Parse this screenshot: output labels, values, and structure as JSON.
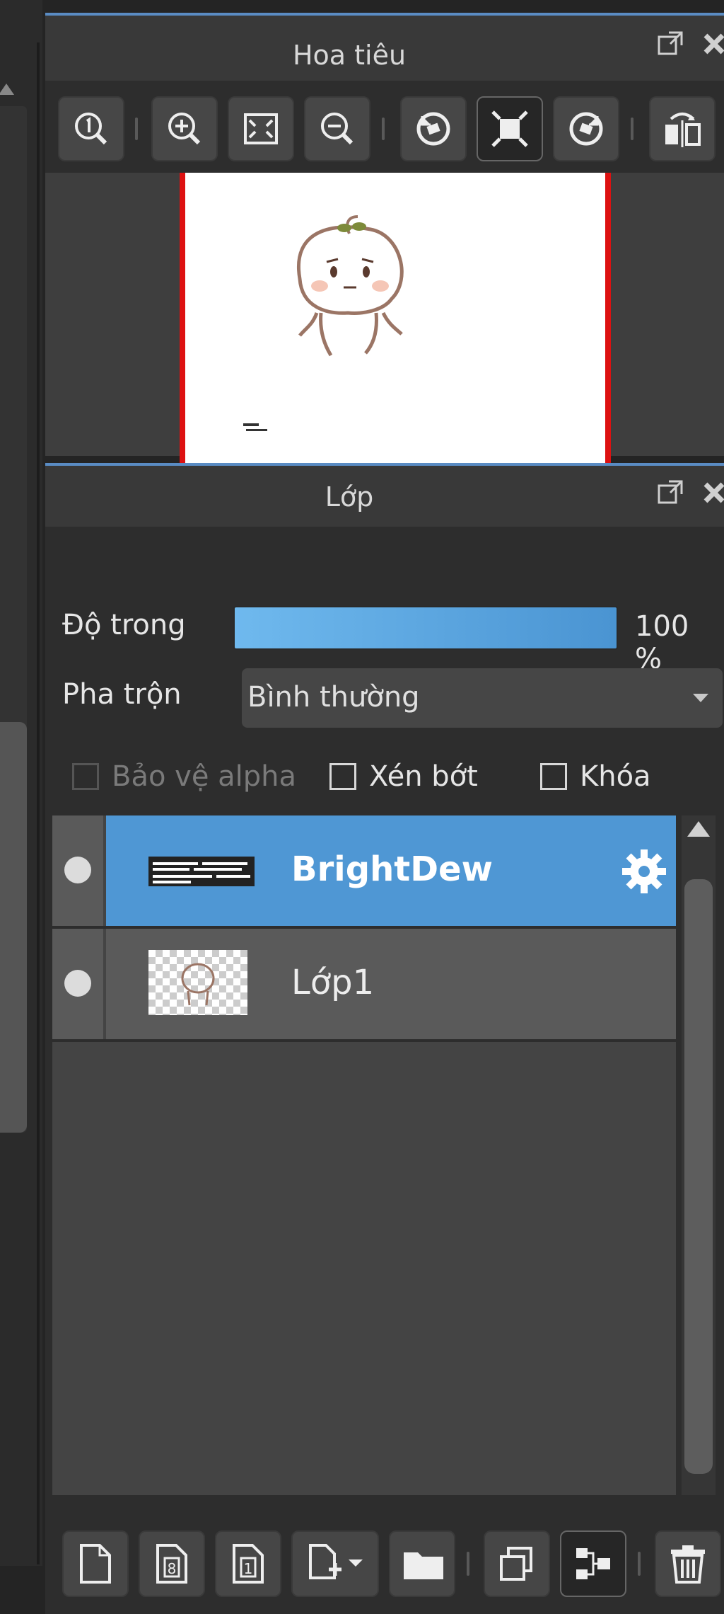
{
  "navigator": {
    "title": "Hoa tiêu",
    "toolbar_icons": [
      "zoom-actual-icon",
      "zoom-in-icon",
      "zoom-fit-icon",
      "zoom-out-icon",
      "rotate-left-icon",
      "fit-screen-icon",
      "rotate-right-icon",
      "flip-icon"
    ]
  },
  "layer_panel": {
    "title": "Lớp",
    "opacity_label": "Độ trong",
    "opacity_value": "100 %",
    "opacity": 1.0,
    "blend_label": "Pha trộn",
    "blend_value": "Bình thường",
    "protect_alpha_label": "Bảo vệ alpha",
    "clipping_label": "Xén bớt",
    "lock_label": "Khóa",
    "layers": [
      {
        "name": "BrightDew",
        "selected": true
      },
      {
        "name": "Lớp1",
        "selected": false
      }
    ],
    "bottom_icons": [
      "new-layer-icon",
      "new-8bit-layer-icon",
      "new-1bit-layer-icon",
      "add-layer-dropdown-icon",
      "folder-icon",
      "duplicate-icon",
      "merge-icon",
      "delete-icon"
    ]
  },
  "colors": {
    "accent": "#4f97d4",
    "panel_bg": "#3a3a3a",
    "canvas_border": "#dd1111"
  }
}
